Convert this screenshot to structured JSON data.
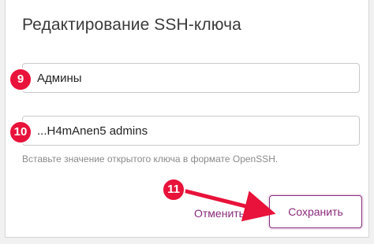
{
  "dialog": {
    "title": "Редактирование SSH-ключа",
    "name_field": {
      "value": "Админы"
    },
    "key_field": {
      "value": "...H4mAnen5 admins"
    },
    "hint": "Вставьте значение открытого ключа в формате OpenSSH.",
    "cancel_label": "Отменить",
    "save_label": "Сохранить"
  },
  "callouts": [
    "9",
    "10",
    "11"
  ],
  "colors": {
    "accent": "#8a2a7a",
    "callout": "#e8123a"
  }
}
